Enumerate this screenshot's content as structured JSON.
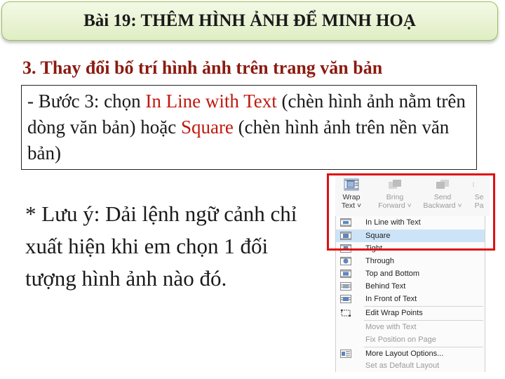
{
  "header": {
    "title": "Bài 19: THÊM HÌNH ẢNH ĐỂ MINH HOẠ"
  },
  "section": {
    "heading": "3. Thay đổi bố trí hình ảnh trên trang văn bản"
  },
  "step": {
    "prefix": "- Bước 3: chọn ",
    "option1": "In Line with Text",
    "middle": " (chèn hình ảnh nằm trên dòng văn bản) hoặc ",
    "option2": "Square",
    "suffix": " (chèn hình ảnh trên nền văn bản)"
  },
  "note": {
    "text": "* Lưu ý: Dải lệnh ngữ cảnh chỉ xuất hiện khi em chọn 1 đối tượng hình ảnh nào đó."
  },
  "ribbon": {
    "wrap_line1": "Wrap",
    "wrap_line2": "Text ˅",
    "bring_line1": "Bring",
    "bring_line2": "Forward ˅",
    "send_line1": "Send",
    "send_line2": "Backward ˅",
    "sel_line1": "Se",
    "sel_line2": "Pa"
  },
  "menu": {
    "items": [
      {
        "label": "In Line with Text",
        "icon": "inline-wrap-icon"
      },
      {
        "label": "Square",
        "icon": "square-wrap-icon"
      },
      {
        "label": "Tight",
        "icon": "tight-wrap-icon"
      },
      {
        "label": "Through",
        "icon": "through-wrap-icon"
      },
      {
        "label": "Top and Bottom",
        "icon": "top-bottom-wrap-icon"
      },
      {
        "label": "Behind Text",
        "icon": "behind-text-icon"
      },
      {
        "label": "In Front of Text",
        "icon": "in-front-text-icon"
      },
      {
        "label": "Edit Wrap Points",
        "icon": "edit-wrap-points-icon"
      },
      {
        "label": "Move with Text"
      },
      {
        "label": "Fix Position on Page"
      },
      {
        "label": "More Layout Options...",
        "icon": "layout-options-icon"
      },
      {
        "label": "Set as Default Layout"
      }
    ]
  },
  "colors": {
    "accent_red": "#c0180e",
    "highlight_box": "#e01010",
    "heading": "#8b1a10",
    "menu_selected": "#cde3f7"
  }
}
